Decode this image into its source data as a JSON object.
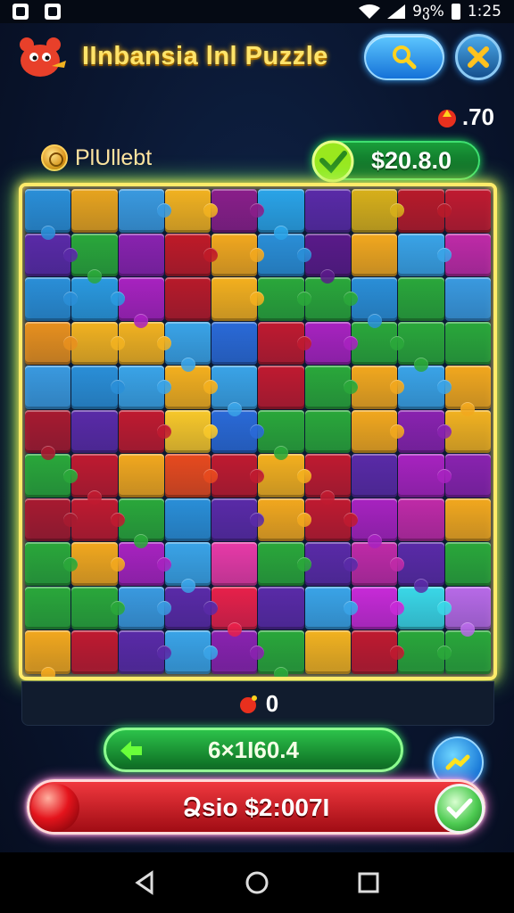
{
  "status_bar": {
    "battery_text": "9ვ%",
    "time": "1:25"
  },
  "header": {
    "title": "IInbansia lnl Puzzle",
    "mascot_icon": "mascot-icon",
    "search_icon": "search-icon",
    "close_icon": "close-icon"
  },
  "top_score": ".70",
  "coins": {
    "label": "PlUllebt",
    "icon": "coin-icon"
  },
  "money": {
    "value": "$20.8.0",
    "icon": "gem-icon"
  },
  "board": {
    "rows": [
      [
        "#2a8fd8",
        "#e8a41e",
        "#3a9ae0",
        "#f2b220",
        "#8a1e8a",
        "#2aa4e8",
        "#5a2aa8",
        "#d8b01a",
        "#b81a2a",
        "#c01a30"
      ],
      [
        "#5a2aa8",
        "#2aa83a",
        "#8a22b0",
        "#c01a28",
        "#f2a81e",
        "#2a8fd8",
        "#5a1a8a",
        "#f2a81e",
        "#3aa4e8",
        "#c02aa8"
      ],
      [
        "#2a8fd8",
        "#2a9ae0",
        "#a822c0",
        "#b81a2a",
        "#f4b01e",
        "#2aa83a",
        "#2aa83a",
        "#2a8fd8",
        "#2aa83a",
        "#3a9ae0"
      ],
      [
        "#e8901e",
        "#f2b220",
        "#f2b220",
        "#3aa4e8",
        "#2a6ad8",
        "#c01a30",
        "#a822c0",
        "#2aa83a",
        "#2aa83a",
        "#2aa83a"
      ],
      [
        "#3a9ae0",
        "#2a8fd8",
        "#3aa4e8",
        "#f4b01e",
        "#3aa4e8",
        "#c01a30",
        "#2aa83a",
        "#f2a81e",
        "#3aa4e8",
        "#f2a81e"
      ],
      [
        "#a81a30",
        "#5a2aa8",
        "#c01a30",
        "#f8c82a",
        "#2a6ad8",
        "#2aa83a",
        "#2aa83a",
        "#f2a81e",
        "#8a22b0",
        "#f2b220"
      ],
      [
        "#2aa83a",
        "#c01a30",
        "#f2a81e",
        "#e84a1e",
        "#c01a30",
        "#f4b01e",
        "#c01a30",
        "#5a2aa8",
        "#a822c0",
        "#8a22b0"
      ],
      [
        "#a81a30",
        "#c01a30",
        "#2aa83a",
        "#2a8fd8",
        "#5a2aa8",
        "#f2a81e",
        "#c01a30",
        "#a822c0",
        "#c02aa8",
        "#f2a81e"
      ],
      [
        "#2aa83a",
        "#f2a81e",
        "#a822c0",
        "#3aa4e8",
        "#e83aa8",
        "#2aa83a",
        "#5a2aa8",
        "#c02aa8",
        "#5a2aa8",
        "#2aa83a"
      ],
      [
        "#2aa83a",
        "#2aa83a",
        "#3a9ae0",
        "#5a2aa8",
        "#e8204a",
        "#5a2aa8",
        "#3aa4e8",
        "#c82ad8",
        "#3ad8e8",
        "#b86ae8"
      ],
      [
        "#f2a81e",
        "#c01a30",
        "#5a2aa8",
        "#3aa4e8",
        "#8a22b0",
        "#2aa83a",
        "#f2b220",
        "#c01a30",
        "#2aa83a",
        "#2aa83a"
      ]
    ]
  },
  "tray": {
    "count": "0",
    "icon": "bomb-icon"
  },
  "moves": {
    "value": "6×1I60.4",
    "icon": "back-arrow-icon"
  },
  "action_bar": {
    "label": "Ձsio $2:007I",
    "left_icon": "red-ball-icon",
    "right_icon": "check-icon"
  },
  "share_icon": "share-icon",
  "nav": {
    "back_icon": "nav-back-icon",
    "home_icon": "nav-home-icon",
    "recents_icon": "nav-recents-icon"
  }
}
